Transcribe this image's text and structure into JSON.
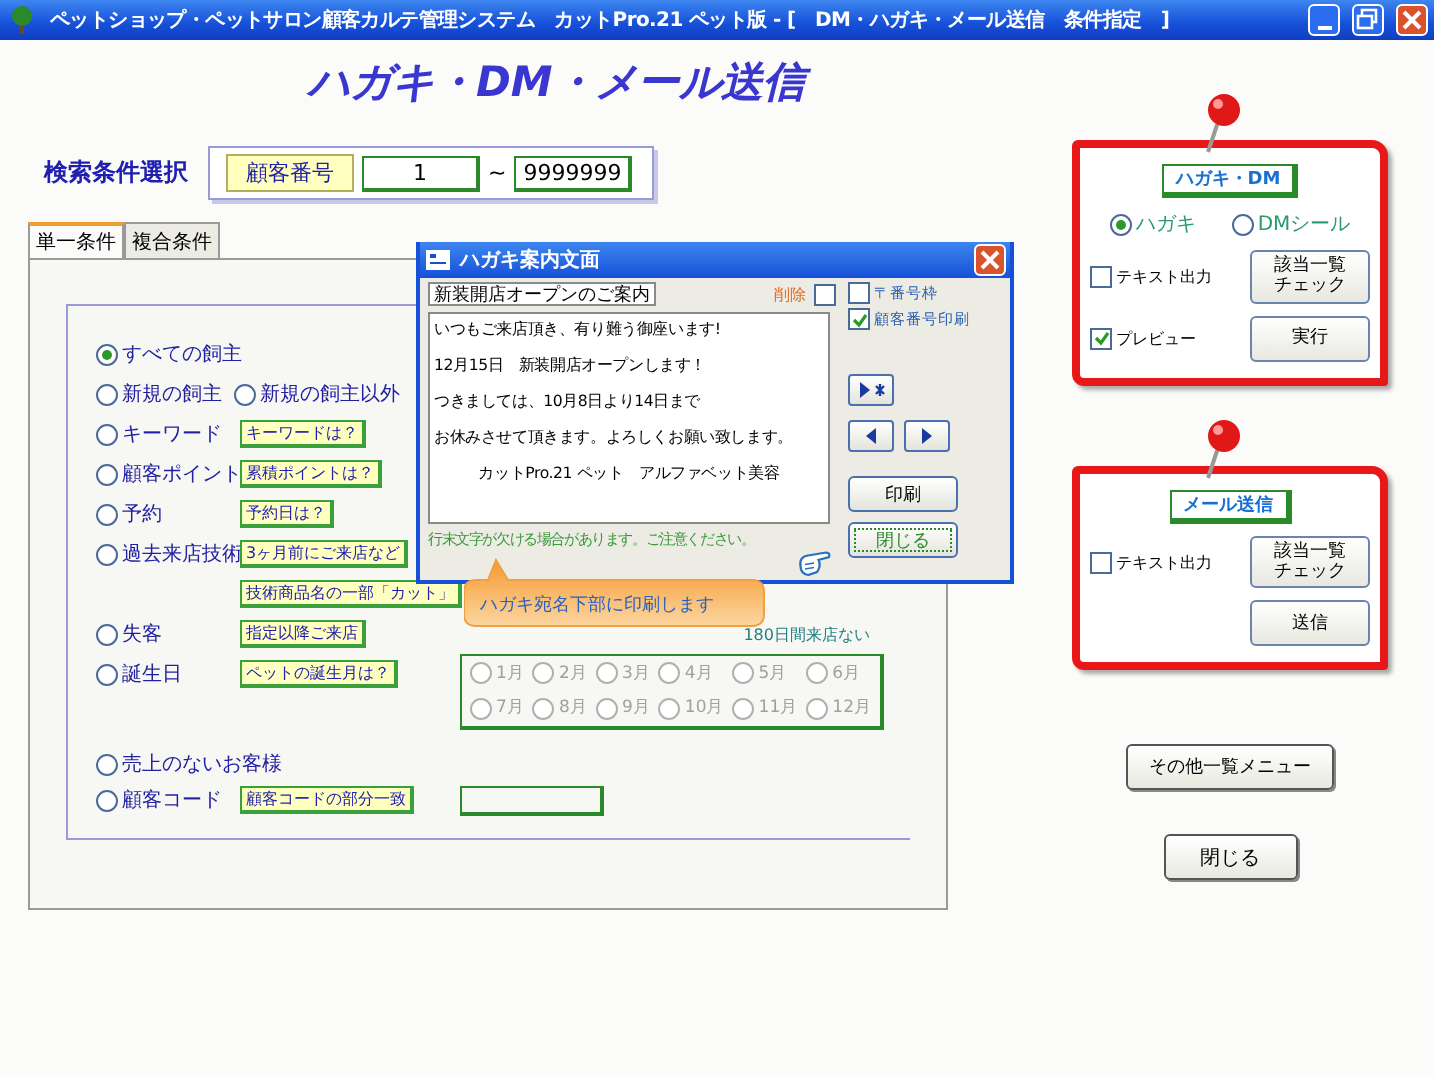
{
  "window": {
    "title": "ペットショップ・ペットサロン顧客カルテ管理システム　カットPro.21 ペット版 - [　DM・ハガキ・メール送信　条件指定　]"
  },
  "heading": "ハガキ・DM・メール送信",
  "search": {
    "label": "検索条件選択",
    "field_label": "顧客番号",
    "from": "1",
    "separator": "~",
    "to": "9999999"
  },
  "tabs": [
    {
      "label": "単一条件",
      "selected": true
    },
    {
      "label": "複合条件",
      "selected": false
    }
  ],
  "conditions": [
    {
      "options": [
        {
          "label": "すべての飼主",
          "selected": true
        }
      ]
    },
    {
      "options": [
        {
          "label": "新規の飼主",
          "selected": false
        },
        {
          "label": "新規の飼主以外",
          "selected": false
        }
      ]
    },
    {
      "options": [
        {
          "label": "キーワード",
          "selected": false
        }
      ],
      "hints": [
        "キーワードは？"
      ]
    },
    {
      "options": [
        {
          "label": "顧客ポイント",
          "selected": false
        }
      ],
      "hints": [
        "累積ポイントは？"
      ]
    },
    {
      "options": [
        {
          "label": "予約",
          "selected": false
        }
      ],
      "hints": [
        "予約日は？"
      ]
    },
    {
      "options": [
        {
          "label": "過去来店技術",
          "selected": false
        }
      ],
      "hints": [
        "3ヶ月前にご来店など",
        "技術商品名の一部「カット」"
      ]
    },
    {
      "options": [
        {
          "label": "失客",
          "selected": false
        }
      ],
      "hints": [
        "指定以降ご来店"
      ]
    },
    {
      "options": [
        {
          "label": "誕生日",
          "selected": false
        }
      ],
      "hints": [
        "ペットの誕生月は？"
      ]
    },
    {
      "options": [
        {
          "label": "売上のないお客様",
          "selected": false
        }
      ]
    },
    {
      "options": [
        {
          "label": "顧客コード",
          "selected": false
        }
      ],
      "hints": [
        "顧客コードの部分一致"
      ]
    }
  ],
  "lapsed_note": "180日間来店ない",
  "months": {
    "disabled": true,
    "items": [
      {
        "label": "1月",
        "selected": false
      },
      {
        "label": "2月",
        "selected": false
      },
      {
        "label": "3月",
        "selected": false
      },
      {
        "label": "4月",
        "selected": false
      },
      {
        "label": "5月",
        "selected": false
      },
      {
        "label": "6月",
        "selected": false
      },
      {
        "label": "7月",
        "selected": false
      },
      {
        "label": "8月",
        "selected": false
      },
      {
        "label": "9月",
        "selected": false
      },
      {
        "label": "10月",
        "selected": false
      },
      {
        "label": "11月",
        "selected": false
      },
      {
        "label": "12月",
        "selected": false
      }
    ]
  },
  "dialog": {
    "title": "ハガキ案内文面",
    "subject": "新装開店オープンのご案内",
    "delete": {
      "label": "削除",
      "checked": false
    },
    "options": [
      {
        "label": "〒番号枠",
        "checked": false
      },
      {
        "label": "顧客番号印刷",
        "checked": true
      }
    ],
    "body_lines": [
      "いつもご来店頂き、有り難う御座います!",
      "12月15日　新装開店オープンします！",
      "つきましては、10月8日より14日まで",
      "お休みさせて頂きます。よろしくお願い致します。",
      "カットPro.21 ペット　アルファベット美容"
    ],
    "buttons": [
      {
        "label": "印刷",
        "focused": false
      },
      {
        "label": "閉じる",
        "focused": true
      }
    ],
    "note": "行末文字が欠ける場合があります。ご注意ください。"
  },
  "callout": "ハガキ宛名下部に印刷します",
  "postcard_panel": {
    "title": "ハガキ・DM",
    "modes": [
      {
        "label": "ハガキ",
        "selected": true
      },
      {
        "label": "DMシール",
        "selected": false
      }
    ],
    "rows": [
      {
        "label": "テキスト出力",
        "checked": false,
        "button": "該当一覧チェック",
        "kind": "two_line"
      },
      {
        "label": "プレビュー",
        "checked": true,
        "button": "実行",
        "kind": "single"
      }
    ]
  },
  "mail_panel": {
    "title": "メール送信",
    "rows": [
      {
        "label": "テキスト出力",
        "checked": false,
        "button": "該当一覧チェック",
        "kind": "two_line"
      },
      {
        "button": "送信",
        "kind": "single"
      }
    ]
  },
  "footer_buttons": [
    "その他一覧メニュー",
    "閉じる"
  ]
}
